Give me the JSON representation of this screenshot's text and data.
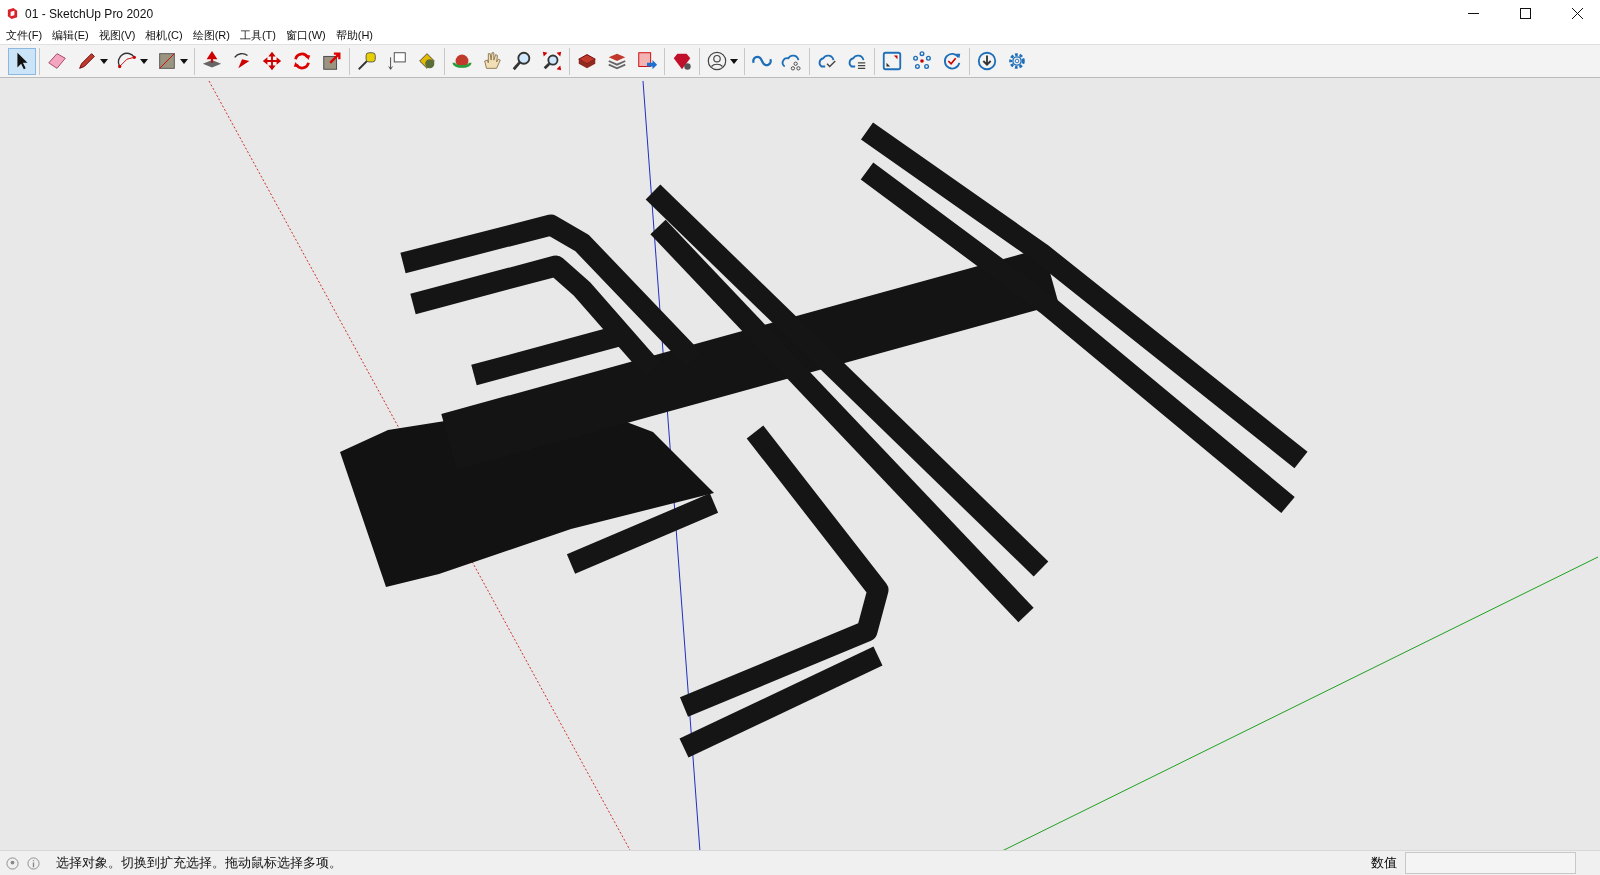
{
  "window": {
    "title": "01 - SketchUp Pro 2020"
  },
  "menu": [
    "文件(F)",
    "编辑(E)",
    "视图(V)",
    "相机(C)",
    "绘图(R)",
    "工具(T)",
    "窗口(W)",
    "帮助(H)"
  ],
  "toolbar": [
    [
      {
        "kind": "select",
        "selected": true,
        "dropdown": false
      }
    ],
    [
      {
        "kind": "eraser",
        "selected": false,
        "dropdown": false
      },
      {
        "kind": "pencil",
        "selected": false,
        "dropdown": true
      },
      {
        "kind": "arc",
        "selected": false,
        "dropdown": true
      },
      {
        "kind": "rectangle",
        "selected": false,
        "dropdown": true
      }
    ],
    [
      {
        "kind": "pushpull",
        "selected": false,
        "dropdown": false
      },
      {
        "kind": "followme",
        "selected": false,
        "dropdown": false
      },
      {
        "kind": "move",
        "selected": false,
        "dropdown": false
      },
      {
        "kind": "rotate",
        "selected": false,
        "dropdown": false
      },
      {
        "kind": "scale",
        "selected": false,
        "dropdown": false
      }
    ],
    [
      {
        "kind": "tape",
        "selected": false,
        "dropdown": false
      },
      {
        "kind": "text",
        "selected": false,
        "dropdown": false
      },
      {
        "kind": "paint",
        "selected": false,
        "dropdown": false
      }
    ],
    [
      {
        "kind": "orbit",
        "selected": false,
        "dropdown": false
      },
      {
        "kind": "pan",
        "selected": false,
        "dropdown": false
      },
      {
        "kind": "zoom",
        "selected": false,
        "dropdown": false
      },
      {
        "kind": "extents",
        "selected": false,
        "dropdown": false
      }
    ],
    [
      {
        "kind": "warehouse",
        "selected": false,
        "dropdown": false
      },
      {
        "kind": "warehouse2",
        "selected": false,
        "dropdown": false
      },
      {
        "kind": "send",
        "selected": false,
        "dropdown": false
      }
    ],
    [
      {
        "kind": "ruby",
        "selected": false,
        "dropdown": false
      }
    ],
    [
      {
        "kind": "profile",
        "selected": false,
        "dropdown": true
      }
    ],
    [
      {
        "kind": "link",
        "selected": false,
        "dropdown": false
      },
      {
        "kind": "cloudshare",
        "selected": false,
        "dropdown": false
      }
    ],
    [
      {
        "kind": "cloudcheck",
        "selected": false,
        "dropdown": false
      },
      {
        "kind": "cloudlist",
        "selected": false,
        "dropdown": false
      }
    ],
    [
      {
        "kind": "frame",
        "selected": false,
        "dropdown": false
      },
      {
        "kind": "nodes",
        "selected": false,
        "dropdown": false
      },
      {
        "kind": "refresh",
        "selected": false,
        "dropdown": false
      }
    ],
    [
      {
        "kind": "download",
        "selected": false,
        "dropdown": false
      },
      {
        "kind": "gear",
        "selected": false,
        "dropdown": false
      }
    ]
  ],
  "status_bar": {
    "message": "选择对象。切换到扩充选择。拖动鼠标选择多项。",
    "measurements_label": "数值"
  }
}
